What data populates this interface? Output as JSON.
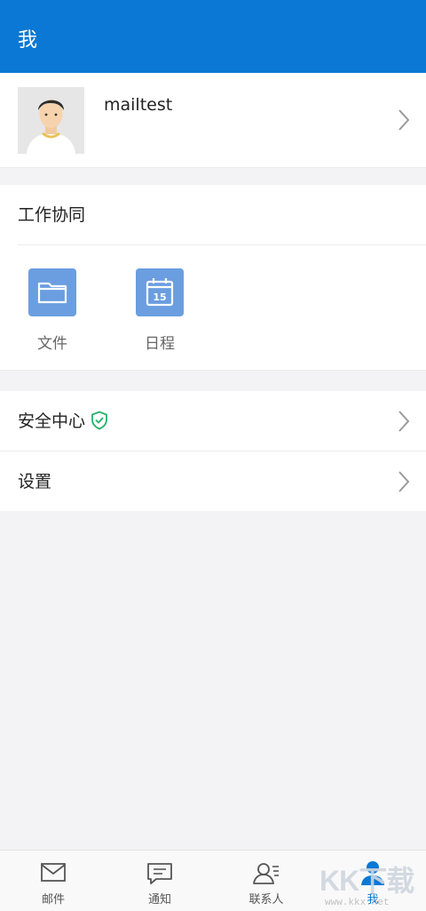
{
  "header": {
    "title": "我"
  },
  "profile": {
    "username": "mailtest"
  },
  "work": {
    "title": "工作协同",
    "apps": [
      {
        "label": "文件",
        "icon": "folder-icon"
      },
      {
        "label": "日程",
        "icon": "calendar-icon",
        "badge": "15"
      }
    ]
  },
  "settings_rows": [
    {
      "label": "安全中心",
      "icon": "shield-check-icon"
    },
    {
      "label": "设置"
    }
  ],
  "tabs": [
    {
      "label": "邮件",
      "icon": "mail-icon"
    },
    {
      "label": "通知",
      "icon": "message-icon"
    },
    {
      "label": "联系人",
      "icon": "contacts-icon"
    },
    {
      "label": "我",
      "icon": "profile-icon",
      "active": true
    }
  ],
  "watermark": {
    "text": "KK下载",
    "url": "www.kkx.net"
  },
  "colors": {
    "header": "#0a78d4",
    "app_icon": "#6a9ee0",
    "shield": "#22b36a",
    "active_tab": "#0a78d4"
  }
}
